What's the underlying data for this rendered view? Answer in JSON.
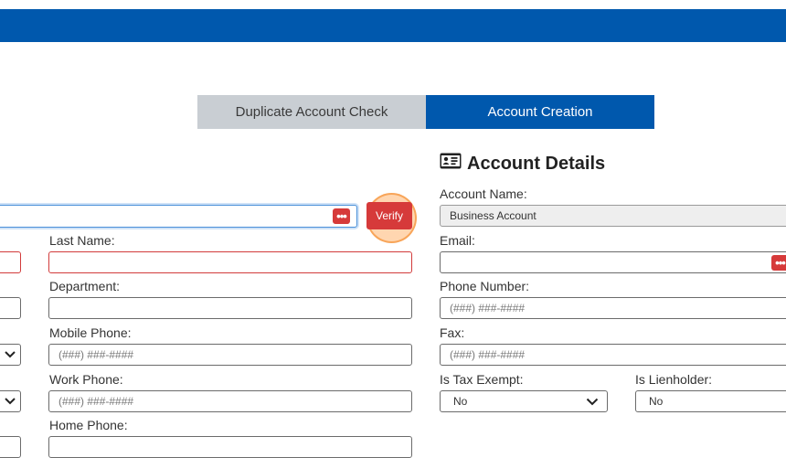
{
  "tabs": {
    "duplicate_check": "Duplicate Account Check",
    "account_creation": "Account Creation"
  },
  "left_form": {
    "verify_label": "Verify",
    "last_name_label": "Last Name:",
    "department_label": "Department:",
    "mobile_phone_label": "Mobile Phone:",
    "mobile_phone_placeholder": "(###) ###-####",
    "work_phone_label": "Work Phone:",
    "work_phone_placeholder": "(###) ###-####",
    "home_phone_label": "Home Phone:"
  },
  "account_details": {
    "heading": "Account Details",
    "account_name_label": "Account Name:",
    "account_name_value": "Business Account",
    "email_label": "Email:",
    "phone_label": "Phone Number:",
    "phone_placeholder": "(###) ###-####",
    "fax_label": "Fax:",
    "fax_placeholder": "(###) ###-####",
    "tax_exempt_label": "Is Tax Exempt:",
    "tax_exempt_value": "No",
    "lienholder_label": "Is Lienholder:",
    "lienholder_value": "No"
  },
  "colors": {
    "brand_blue": "#0058ad",
    "error_red": "#d63a3a",
    "inactive_tab": "#c9ced3"
  },
  "icons": {
    "more": "ellipsis-icon",
    "dropdown": "chevron-down-icon",
    "details": "id-card-icon"
  }
}
